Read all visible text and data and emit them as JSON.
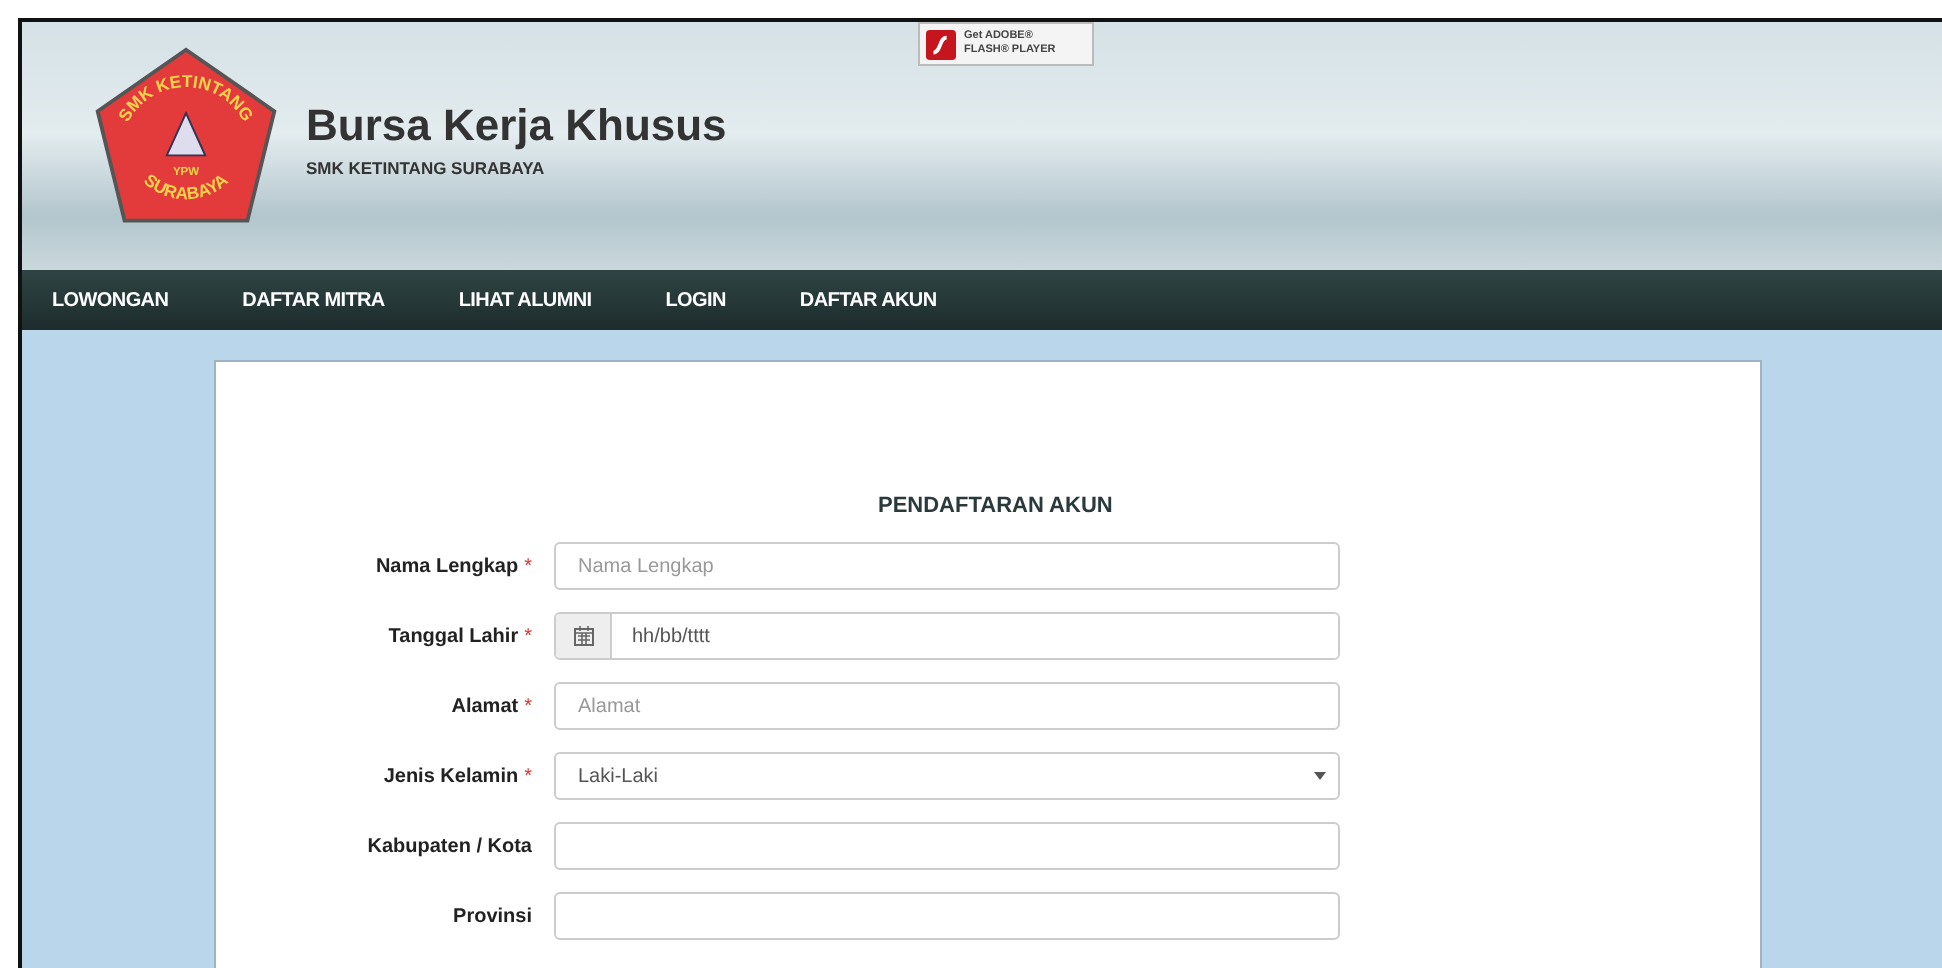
{
  "header": {
    "logo": {
      "top": "SMK KETINTANG",
      "middle": "YPW",
      "bottom": "SURABAYA"
    },
    "title": "Bursa Kerja Khusus",
    "subtitle": "SMK KETINTANG SURABAYA",
    "flash_badge": {
      "line1": "Get ADOBE®",
      "line2": "FLASH® PLAYER"
    }
  },
  "nav": [
    {
      "label": "LOWONGAN"
    },
    {
      "label": "DAFTAR MITRA"
    },
    {
      "label": "LIHAT ALUMNI"
    },
    {
      "label": "LOGIN"
    },
    {
      "label": "DAFTAR AKUN"
    }
  ],
  "form": {
    "title": "PENDAFTARAN AKUN",
    "fields": [
      {
        "kind": "text",
        "label": "Nama Lengkap",
        "required_mark": "*",
        "placeholder": "Nama Lengkap"
      },
      {
        "kind": "date",
        "label": "Tanggal Lahir",
        "required_mark": "*",
        "placeholder": "hh/bb/tttt"
      },
      {
        "kind": "text",
        "label": "Alamat",
        "required_mark": "*",
        "placeholder": "Alamat"
      },
      {
        "kind": "select",
        "label": "Jenis Kelamin",
        "required_mark": "*",
        "value": "Laki-Laki"
      },
      {
        "kind": "text",
        "label": "Kabupaten / Kota"
      },
      {
        "kind": "text",
        "label": "Provinsi"
      }
    ]
  }
}
